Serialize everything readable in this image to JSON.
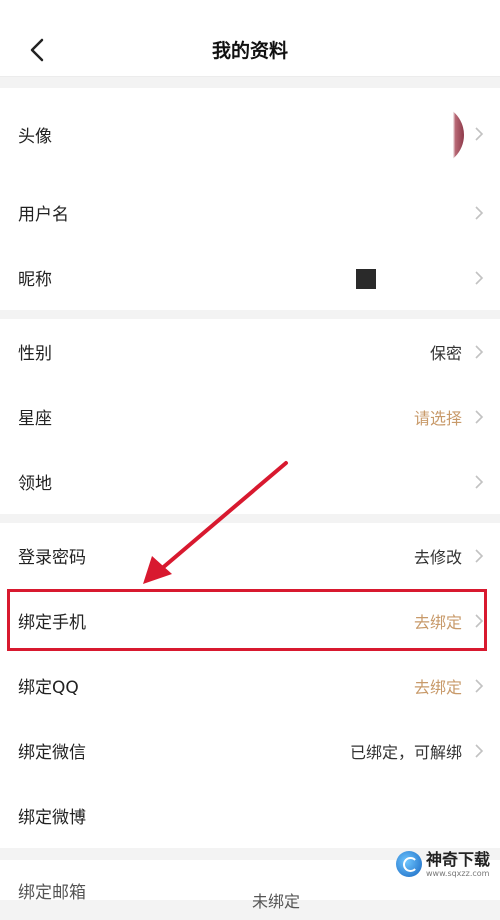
{
  "header": {
    "title": "我的资料",
    "back_icon": "chevron-left-icon"
  },
  "profile": {
    "avatar_label": "头像",
    "username_label": "用户名",
    "nickname_label": "昵称"
  },
  "details": {
    "gender_label": "性别",
    "gender_value": "保密",
    "zodiac_label": "星座",
    "zodiac_value": "请选择",
    "territory_label": "领地"
  },
  "account": {
    "password_label": "登录密码",
    "password_action": "去修改",
    "phone_label": "绑定手机",
    "phone_action": "去绑定",
    "qq_label": "绑定QQ",
    "qq_action": "去绑定",
    "wechat_label": "绑定微信",
    "wechat_value": "已绑定，可解绑",
    "weibo_label": "绑定微博",
    "email_label": "绑定邮箱",
    "email_value": "未绑定"
  },
  "annotation": {
    "highlight_color": "#d8192f"
  },
  "watermark": {
    "title": "神奇下载",
    "url": "www.sqxzz.com"
  },
  "colors": {
    "accent": "#c89a6a",
    "background": "#f3f3f3"
  }
}
